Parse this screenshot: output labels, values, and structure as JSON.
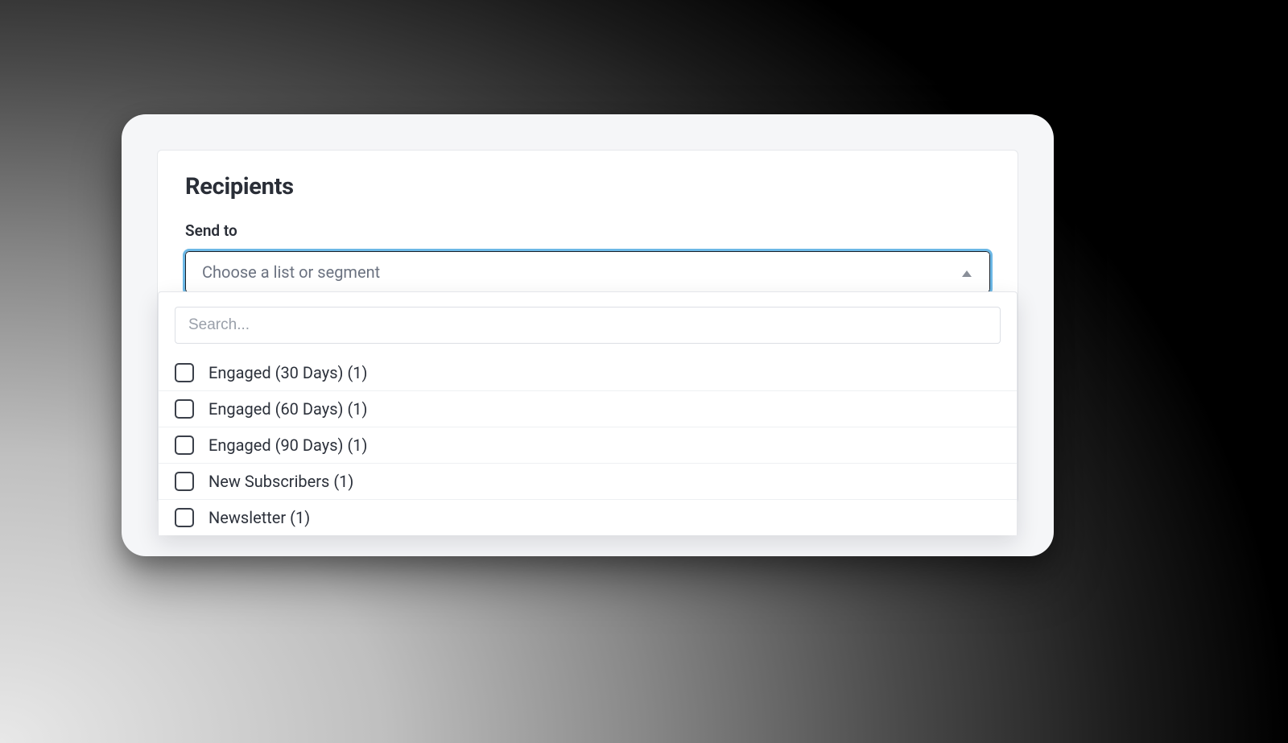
{
  "panel": {
    "title": "Recipients",
    "field_label": "Send to"
  },
  "select": {
    "placeholder": "Choose a list or segment"
  },
  "dropdown": {
    "search_placeholder": "Search...",
    "options": [
      {
        "label": "Engaged (30 Days) (1)"
      },
      {
        "label": "Engaged (60 Days) (1)"
      },
      {
        "label": "Engaged (90 Days) (1)"
      },
      {
        "label": "New Subscribers (1)"
      },
      {
        "label": "Newsletter (1)"
      }
    ]
  },
  "colors": {
    "focus_ring": "#6cb8e6",
    "text": "#2a2e37",
    "muted": "#6b7280"
  }
}
